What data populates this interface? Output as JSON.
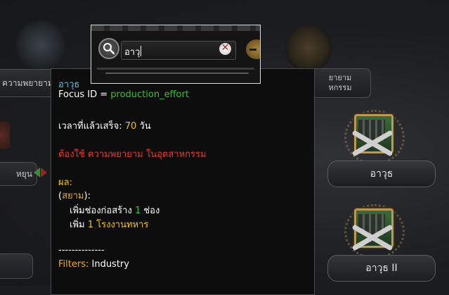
{
  "search": {
    "query": "อาวุ"
  },
  "tree": {
    "left_top_label": "ความพยายาม",
    "right_top_label_line1": "ยายาม",
    "right_top_label_line2": "หกรรม",
    "left_mid_label": "หยุน",
    "focuses": [
      {
        "label": "อาวุธ"
      },
      {
        "label": "อาวุธ II"
      }
    ]
  },
  "tooltip": {
    "title": "อาวุธ",
    "focus_id_key": "Focus ID = ",
    "focus_id_value": "production_effort",
    "time_label": "เวลาที่แล้วเสร็จ: ",
    "time_value": "70",
    "time_unit": " วัน",
    "requires": "ต้องใช้ ความพยายาม ในอุตสาหกรรม",
    "effects_label": "ผล:",
    "country_open": "(",
    "country": "สยาม",
    "country_close": "):",
    "effect1_prefix": "เพิ่มช่องก่อสร้าง ",
    "effect1_value": "1",
    "effect1_suffix": " ช่อง",
    "effect2_prefix": "เพิ่ม ",
    "effect2_value": "1",
    "effect2_suffix": " โรงงานทหาร",
    "separator": "--------------",
    "filters_label": "Filters:",
    "filters_value": " Industry"
  },
  "colors": {
    "title": "#42c5ef",
    "id_value": "#36c02f",
    "number": "#f2c21a",
    "requirement": "#e8382e",
    "country": "#f2a81d"
  },
  "icons": [
    "search-icon",
    "clear-icon",
    "minus-icon",
    "factory-icon",
    "crossed-guns-icon",
    "anchor-emblem-icon",
    "hammer-emblem-icon"
  ]
}
